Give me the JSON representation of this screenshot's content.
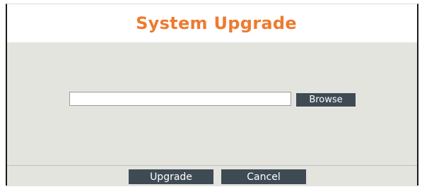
{
  "header": {
    "title": "System Upgrade"
  },
  "file_picker": {
    "value": "",
    "browse_label": "Browse"
  },
  "actions": {
    "upgrade_label": "Upgrade",
    "cancel_label": "Cancel"
  },
  "colors": {
    "title": "#ee7a2e",
    "button_bg": "#3f4b54",
    "panel_bg": "#e4e4df"
  }
}
